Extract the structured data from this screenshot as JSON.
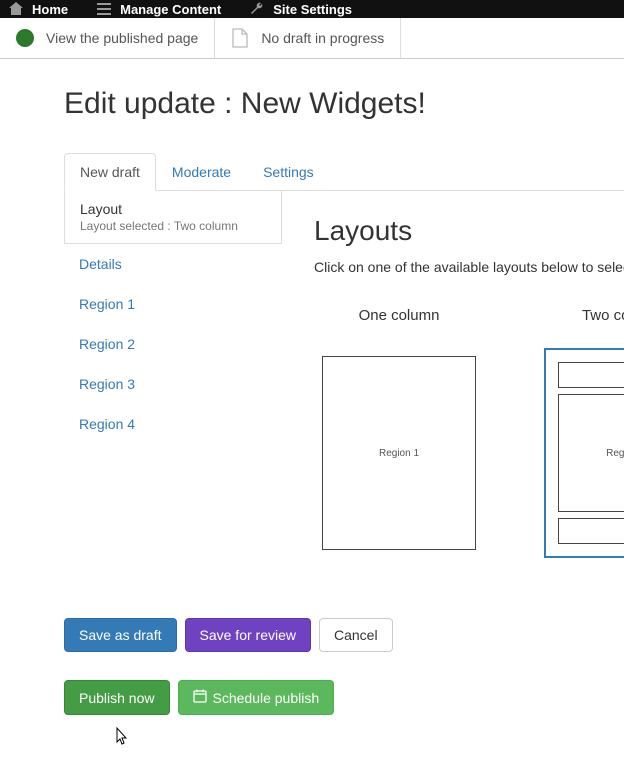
{
  "topnav": {
    "home": "Home",
    "manage": "Manage Content",
    "settings": "Site Settings"
  },
  "subnav": {
    "view_published": "View the published page",
    "no_draft": "No draft in progress"
  },
  "page_title": "Edit update : New Widgets!",
  "tabs": {
    "new_draft": "New draft",
    "moderate": "Moderate",
    "settings": "Settings"
  },
  "sidemenu": {
    "layout_heading": "Layout",
    "layout_sub": "Layout selected : Two column",
    "details": "Details",
    "region1": "Region 1",
    "region2": "Region 2",
    "region3": "Region 3",
    "region4": "Region 4"
  },
  "main": {
    "heading": "Layouts",
    "hint": "Click on one of the available layouts below to select it.",
    "one_col": "One column",
    "two_col": "Two column",
    "region1_lbl": "Region 1",
    "region_lbl_partial": "Region"
  },
  "buttons": {
    "save_draft": "Save as draft",
    "save_review": "Save for review",
    "cancel": "Cancel",
    "publish_now": "Publish now",
    "schedule": "Schedule publish"
  }
}
